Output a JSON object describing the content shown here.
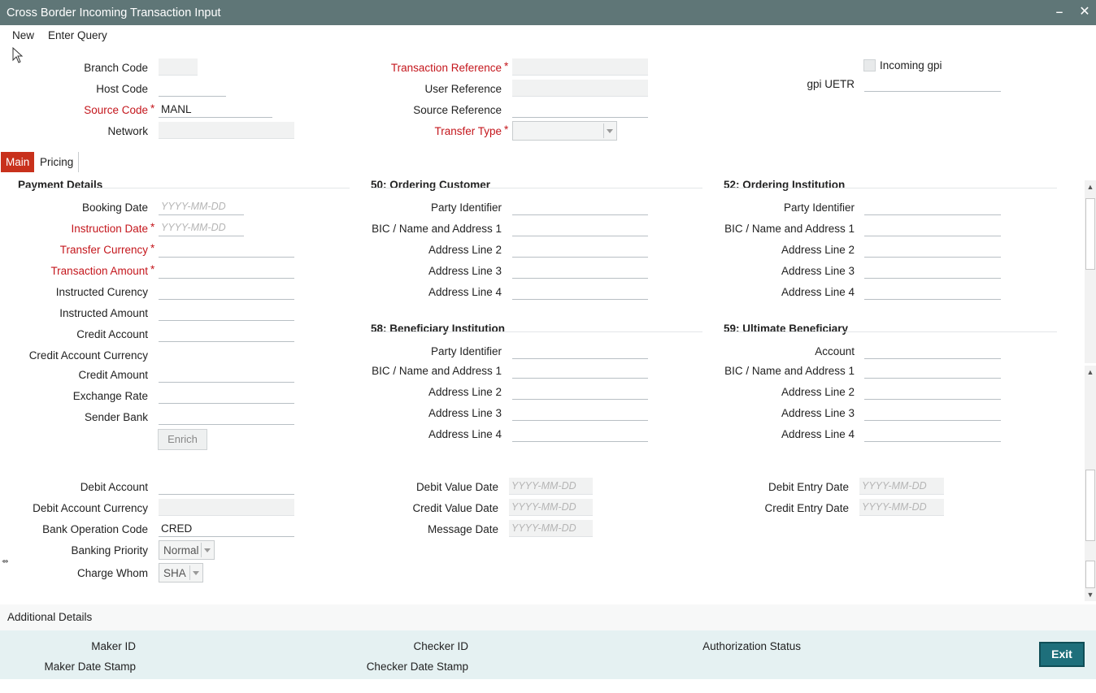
{
  "window": {
    "title": "Cross Border Incoming Transaction Input",
    "minimize_icon": "minimize-icon",
    "close_icon": "close-icon"
  },
  "menu": {
    "new": "New",
    "enter_query": "Enter Query"
  },
  "header": {
    "branch_code": {
      "label": "Branch Code",
      "value": ""
    },
    "host_code": {
      "label": "Host Code",
      "value": ""
    },
    "source_code": {
      "label": "Source Code",
      "value": "MANL"
    },
    "network": {
      "label": "Network",
      "value": ""
    },
    "transaction_reference": {
      "label": "Transaction Reference",
      "value": ""
    },
    "user_reference": {
      "label": "User Reference",
      "value": ""
    },
    "source_reference": {
      "label": "Source Reference",
      "value": ""
    },
    "transfer_type": {
      "label": "Transfer Type",
      "value": ""
    },
    "incoming_gpi": {
      "label": "Incoming gpi",
      "checked": false
    },
    "gpi_uetr": {
      "label": "gpi UETR",
      "value": ""
    }
  },
  "required_mark": "*",
  "tabs": {
    "main": "Main",
    "pricing": "Pricing"
  },
  "date_placeholder": "YYYY-MM-DD",
  "payment_details": {
    "title": "Payment Details",
    "booking_date": "Booking Date",
    "instruction_date": "Instruction Date",
    "transfer_currency": "Transfer Currency",
    "transaction_amount": "Transaction Amount",
    "instructed_currency": "Instructed Curency",
    "instructed_amount": "Instructed Amount",
    "credit_account": "Credit Account",
    "credit_account_currency": "Credit Account Currency",
    "credit_amount": "Credit Amount",
    "exchange_rate": "Exchange Rate",
    "sender_bank": "Sender Bank",
    "enrich": "Enrich"
  },
  "ordering_customer": {
    "title": "50: Ordering Customer",
    "party_identifier": "Party Identifier",
    "bic_name_address1": "BIC / Name and Address 1",
    "address_line2": "Address Line 2",
    "address_line3": "Address Line 3",
    "address_line4": "Address Line 4"
  },
  "ordering_institution": {
    "title": "52: Ordering Institution",
    "party_identifier": "Party Identifier",
    "bic_name_address1": "BIC / Name and Address 1",
    "address_line2": "Address Line 2",
    "address_line3": "Address Line 3",
    "address_line4": "Address Line 4"
  },
  "beneficiary_institution": {
    "title": "58: Beneficiary Institution",
    "party_identifier": "Party Identifier",
    "bic_name_address1": "BIC / Name and Address 1",
    "address_line2": "Address Line 2",
    "address_line3": "Address Line 3",
    "address_line4": "Address Line 4"
  },
  "ultimate_beneficiary": {
    "title": "59: Ultimate Beneficiary",
    "account": "Account",
    "bic_name_address1": "BIC / Name and Address 1",
    "address_line2": "Address Line 2",
    "address_line3": "Address Line 3",
    "address_line4": "Address Line 4"
  },
  "debit": {
    "debit_account": "Debit Account",
    "debit_account_currency": "Debit Account Currency",
    "bank_operation_code": {
      "label": "Bank Operation Code",
      "value": "CRED"
    },
    "banking_priority": {
      "label": "Banking Priority",
      "value": "Normal"
    },
    "charge_whom": {
      "label": "Charge Whom",
      "value": "SHA"
    },
    "debit_value_date": "Debit Value Date",
    "credit_value_date": "Credit Value Date",
    "message_date": "Message Date",
    "debit_entry_date": "Debit Entry Date",
    "credit_entry_date": "Credit Entry Date"
  },
  "additional_details": "Additional Details",
  "footer": {
    "maker_id": "Maker ID",
    "maker_date_stamp": "Maker Date Stamp",
    "checker_id": "Checker ID",
    "checker_date_stamp": "Checker Date Stamp",
    "authorization_status": "Authorization Status",
    "exit": "Exit"
  }
}
